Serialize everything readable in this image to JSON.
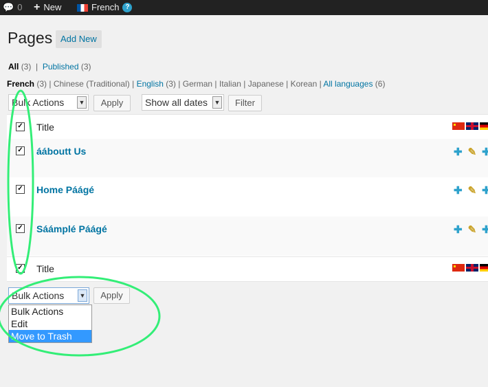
{
  "adminbar": {
    "comments_count": "0",
    "new_label": "New",
    "language": "French"
  },
  "page": {
    "title": "Pages",
    "add_new": "Add New"
  },
  "status_filter": {
    "all": "All",
    "all_count": "(3)",
    "sep": "|",
    "published": "Published",
    "published_count": "(3)"
  },
  "languages": [
    {
      "label": "French",
      "count": "(3)"
    },
    {
      "label": "Chinese (Traditional)"
    },
    {
      "label": "English",
      "count": "(3)"
    },
    {
      "label": "German"
    },
    {
      "label": "Italian"
    },
    {
      "label": "Japanese"
    },
    {
      "label": "Korean"
    },
    {
      "label": "All languages",
      "count": "(6)"
    }
  ],
  "toolbar": {
    "bulk_actions": "Bulk Actions",
    "apply": "Apply",
    "dates": "Show all dates",
    "filter": "Filter"
  },
  "table": {
    "header_title": "Title",
    "footer_title": "Title",
    "rows": [
      {
        "title": "ááboutt Us"
      },
      {
        "title": "Home Páágé"
      },
      {
        "title": "Sáámplé Páágé"
      }
    ]
  },
  "bottom": {
    "bulk_actions": "Bulk Actions",
    "apply": "Apply",
    "options": [
      "Bulk Actions",
      "Edit",
      "Move to Trash"
    ],
    "highlighted_option": "Move to Trash"
  },
  "colors": {
    "link": "#0074a2",
    "highlight": "#3399ff",
    "annotation": "#33ee77"
  },
  "icons": [
    "comment-icon",
    "plus-icon",
    "flag-fr-icon",
    "help-icon",
    "flag-cn-icon",
    "flag-gb-icon",
    "flag-de-icon",
    "add-translation-icon",
    "edit-translation-icon"
  ]
}
